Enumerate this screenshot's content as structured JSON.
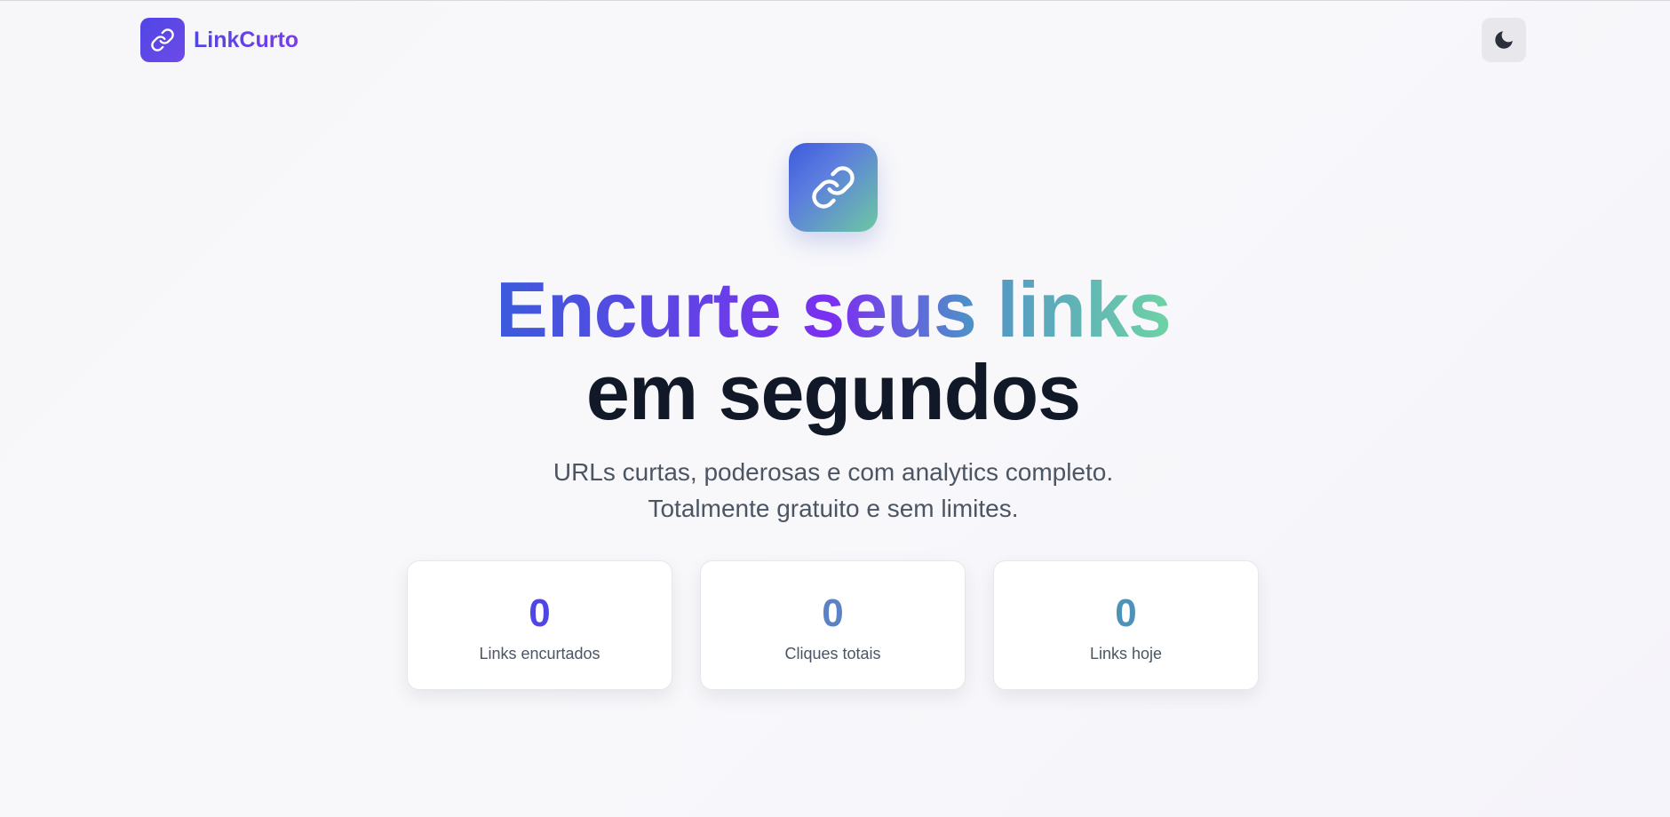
{
  "header": {
    "brand_name": "LinkCurto",
    "brand_icon": "link-icon",
    "theme_toggle_icon": "moon-icon"
  },
  "hero": {
    "icon": "link-icon",
    "headline_line1": "Encurte seus links",
    "headline_line2": "em segundos",
    "subtitle_line1": "URLs curtas, poderosas e com analytics completo.",
    "subtitle_line2": "Totalmente gratuito e sem limites."
  },
  "stats": [
    {
      "value": "0",
      "label": "Links encurtados",
      "color": "#4f46e5"
    },
    {
      "value": "0",
      "label": "Cliques totais",
      "color": "#5b82c4"
    },
    {
      "value": "0",
      "label": "Links hoje",
      "color": "#4d92b8"
    }
  ],
  "colors": {
    "accent": "#4f46e5",
    "accent_purple": "#7c3aed",
    "gradient_green": "#6fd3a5",
    "text_dark": "#111827",
    "text_muted": "#4b5563"
  }
}
